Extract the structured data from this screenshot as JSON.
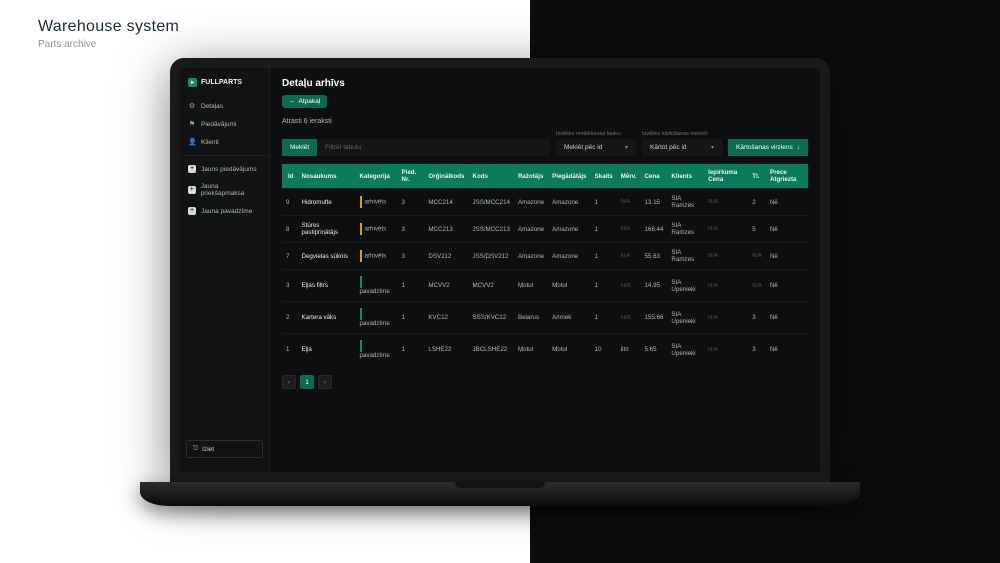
{
  "heading": {
    "title": "Warehouse system",
    "subtitle": "Parts archive"
  },
  "brand": {
    "name": "FULLPARTS",
    "icon_glyph": "▸"
  },
  "sidebar": {
    "nav": [
      {
        "icon": "⚙",
        "label": "Detaļas"
      },
      {
        "icon": "⚑",
        "label": "Piedāvājumi"
      },
      {
        "icon": "👤",
        "label": "Klienti"
      }
    ],
    "actions": [
      {
        "label": "Jauns piedāvājums"
      },
      {
        "label": "Jauna priekšapmaksa"
      },
      {
        "label": "Jauna pavadzīme"
      }
    ],
    "logout": {
      "label": "Iziet",
      "icon": "⎋"
    }
  },
  "main": {
    "title": "Detaļu arhīvs",
    "back_label": "Atpakaļ",
    "result_count": "Atrasti 6 ieraksti",
    "filters": {
      "search_button": "Meklēt",
      "filter_placeholder": "Filtrēt tabulu",
      "select1": {
        "label": "Izvēlies meklēšanas lauku:",
        "value": "Meklēt pēc id"
      },
      "select2": {
        "label": "Izvēlies kārtošanas metodi:",
        "value": "Kārtot pēc id"
      },
      "sort_button": "Kārtošanas virziens"
    },
    "columns": [
      "Id",
      "Nosaukums",
      "Kategorija",
      "Pied. Nr.",
      "Orģinālkods",
      "Kods",
      "Ražotājs",
      "Piegādātājs",
      "Skaits",
      "Mērv.",
      "Cena",
      "Klients",
      "Iepirkuma Cena",
      "Tl.",
      "Prece Atgriezta"
    ],
    "rows": [
      {
        "id": "9",
        "name": "Hidromufte",
        "category": "arhivēts",
        "cat_class": "cat-arhivets",
        "pied": "3",
        "orig": "MCC214",
        "kods": "JSS/MCC214",
        "razotajs": "Amazone",
        "piegadatajs": "Amazone",
        "skaits": "1",
        "merv": "N/A",
        "cena": "13.15",
        "klients": "SIA Ramzes",
        "iep": "N/A",
        "tl": "2",
        "atgriezta": "Nē"
      },
      {
        "id": "8",
        "name": "Stūres pastiprinātājs",
        "category": "arhivēts",
        "cat_class": "cat-arhivets",
        "pied": "3",
        "orig": "MCC213",
        "kods": "JSS/MCC213",
        "razotajs": "Amazone",
        "piegadatajs": "Amazone",
        "skaits": "1",
        "merv": "N/A",
        "cena": "166.44",
        "klients": "SIA Ramzes",
        "iep": "N/A",
        "tl": "5",
        "atgriezta": "Nē"
      },
      {
        "id": "7",
        "name": "Degvielas sūknis",
        "category": "arhivēts",
        "cat_class": "cat-arhivets",
        "pied": "3",
        "orig": "DSV212",
        "kods": "JSS/DSV212",
        "razotajs": "Amazone",
        "piegadatajs": "Amazone",
        "skaits": "1",
        "merv": "N/A",
        "cena": "55.63",
        "klients": "SIA Ramzes",
        "iep": "N/A",
        "tl": "N/A",
        "atgriezta": "Nē"
      },
      {
        "id": "3",
        "name": "Eļļas filtrs",
        "category": "pavadzīme",
        "cat_class": "cat-pavadzime",
        "pied": "1",
        "orig": "MCVV2",
        "kods": "MCVV2",
        "razotajs": "Motul",
        "piegadatajs": "Motul",
        "skaits": "1",
        "merv": "N/A",
        "cena": "14.95",
        "klients": "SIA Upenieki",
        "iep": "N/A",
        "tl": "N/A",
        "atgriezta": "Nē"
      },
      {
        "id": "2",
        "name": "Kartera vāks",
        "category": "pavadzīme",
        "cat_class": "cat-pavadzime",
        "pied": "1",
        "orig": "KVC12",
        "kods": "SSS/KVC12",
        "razotajs": "Belarus",
        "piegadatajs": "Amnek",
        "skaits": "1",
        "merv": "N/A",
        "cena": "155.66",
        "klients": "SIA Upenieki",
        "iep": "N/A",
        "tl": "3",
        "atgriezta": "Nē"
      },
      {
        "id": "1",
        "name": "Eļļa",
        "category": "pavadzīme",
        "cat_class": "cat-pavadzime",
        "pied": "1",
        "orig": "LSHE22",
        "kods": "JBCLSHE22",
        "razotajs": "Motul",
        "piegadatajs": "Motul",
        "skaits": "10",
        "merv": "litri",
        "cena": "5.65",
        "klients": "SIA Upenieki",
        "iep": "N/A",
        "tl": "3",
        "atgriezta": "Nē"
      }
    ],
    "pagination": {
      "prev": "‹",
      "current": "1",
      "next": "›"
    }
  }
}
